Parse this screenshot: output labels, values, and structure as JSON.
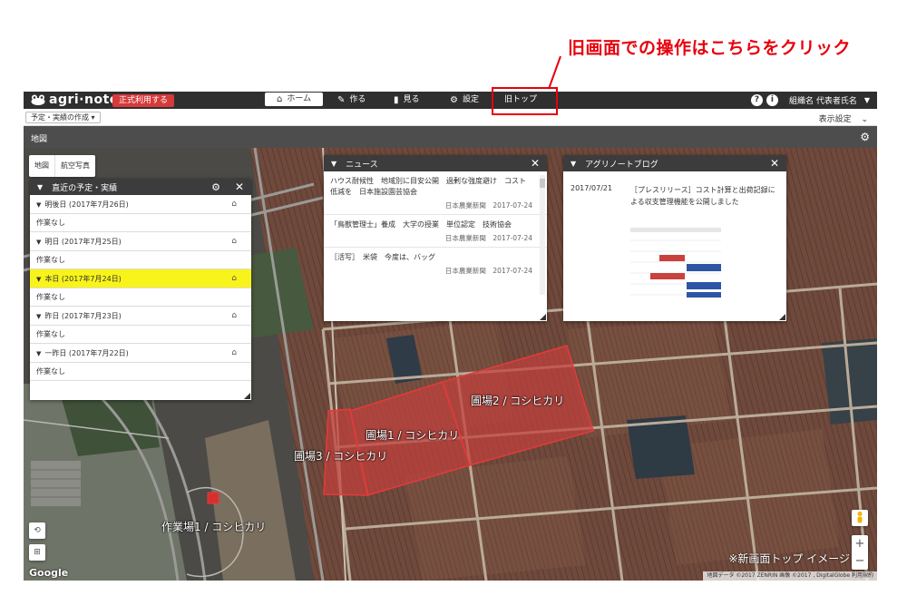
{
  "annotation": {
    "text": "旧画面での操作はこちらをクリック",
    "color": "#e8000b"
  },
  "app": {
    "brand": "agri·note",
    "official_label": "正式利用する"
  },
  "nav": {
    "home": "ホーム",
    "create": "作る",
    "view": "見る",
    "settings": "設定",
    "old_top": "旧トップ",
    "help": "?",
    "info": "i",
    "org_user": "組織名 代表者氏名"
  },
  "subbar": {
    "plan_button": "予定・実績の作成",
    "display_settings": "表示設定"
  },
  "section": {
    "title": "地図"
  },
  "map": {
    "type_map": "地図",
    "type_satellite": "航空写真",
    "fields": [
      "圃場2 / コシヒカリ",
      "圃場1 / コシヒカリ",
      "圃場3 / コシヒカリ",
      "作業場1 / コシヒカリ"
    ],
    "google": "Google",
    "attribution": "地図データ ©2017 ZENRIN 画像 ©2017 , DigitalGlobe   利用規約",
    "caption": "※新画面トップ イメージ",
    "zoom_in": "+",
    "zoom_out": "−"
  },
  "schedule": {
    "title": "直近の予定・実績",
    "days": [
      {
        "label": "明後日 (2017年7月26日)",
        "status": "作業なし",
        "today": false
      },
      {
        "label": "明日 (2017年7月25日)",
        "status": "作業なし",
        "today": false
      },
      {
        "label": "本日 (2017年7月24日)",
        "status": "作業なし",
        "today": true
      },
      {
        "label": "昨日 (2017年7月23日)",
        "status": "作業なし",
        "today": false
      },
      {
        "label": "一昨日 (2017年7月22日)",
        "status": "作業なし",
        "today": false
      }
    ],
    "highlight_color": "#f8f31b"
  },
  "news": {
    "title": "ニュース",
    "items": [
      {
        "title": "ハウス耐候性　地域別に目安公開　過剰な強度避け　コスト低減を　日本施設園芸協会",
        "source": "日本農業新聞",
        "date": "2017-07-24"
      },
      {
        "title": "「鳥獣管理士」養成　大学の授業　単位認定　技術協会",
        "source": "日本農業新聞",
        "date": "2017-07-24"
      },
      {
        "title": "［活写］　米袋　今度は、バッグ",
        "source": "日本農業新聞",
        "date": "2017-07-24"
      }
    ]
  },
  "blog": {
    "title": "アグリノートブログ",
    "date": "2017/07/21",
    "post_title": "［プレスリリース］コスト計算と出荷記録による収支管理機能を公開しました"
  }
}
